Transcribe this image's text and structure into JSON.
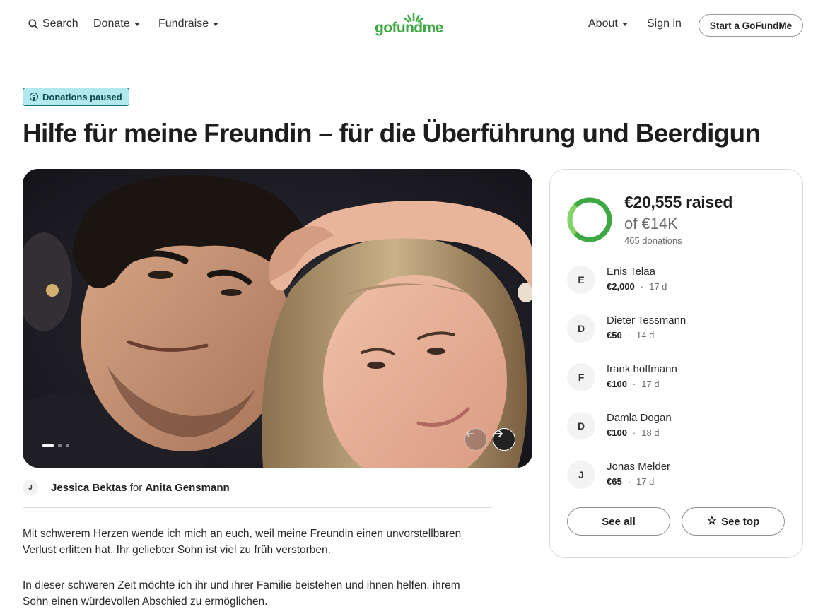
{
  "header": {
    "search_label": "Search",
    "donate_label": "Donate",
    "fundraise_label": "Fundraise",
    "logo_text": "gofundme",
    "about_label": "About",
    "signin_label": "Sign in",
    "start_label": "Start a GoFundMe"
  },
  "campaign": {
    "status_badge": "Donations paused",
    "title": "Hilfe für meine Freundin – für die Überführung und Beerdigun",
    "slides": {
      "count": 3,
      "active": 1
    }
  },
  "organizer": {
    "avatar_initial": "J",
    "name": "Jessica Bektas",
    "connector": "for",
    "beneficiary": "Anita Gensmann"
  },
  "story": {
    "paragraphs": [
      [
        "Mit schwerem Herzen wende ich mich an euch, weil meine Freundin einen unvorstellbaren",
        "Verlust erlitten hat. Ihr geliebter Sohn ist viel zu früh verstorben."
      ],
      [
        "In dieser schweren Zeit möchte ich ihr und ihrer Familie beistehen und ihnen helfen, ihrem",
        "Sohn einen würdevollen Abschied zu ermöglichen."
      ]
    ]
  },
  "donation_card": {
    "raised": "€20,555 raised",
    "goal": "of €14K",
    "count": "465 donations",
    "progress": 1.0,
    "accent_color": "#3ea843",
    "donors": [
      {
        "initial": "E",
        "name": "Enis Telaa",
        "amount": "€2,000",
        "age": "17 d"
      },
      {
        "initial": "D",
        "name": "Dieter Tessmann",
        "amount": "€50",
        "age": "14 d"
      },
      {
        "initial": "F",
        "name": "frank hoffmann",
        "amount": "€100",
        "age": "17 d"
      },
      {
        "initial": "D",
        "name": "Damla Dogan",
        "amount": "€100",
        "age": "18 d"
      },
      {
        "initial": "J",
        "name": "Jonas Melder",
        "amount": "€65",
        "age": "17 d"
      }
    ],
    "see_all_label": "See all",
    "see_top_label": "See top",
    "separator": "·"
  },
  "icons": {
    "search": "search-icon",
    "caret": "chevron-down-icon",
    "info": "info-icon",
    "prev": "arrow-left-icon",
    "next": "arrow-right-icon",
    "star": "star-icon"
  }
}
